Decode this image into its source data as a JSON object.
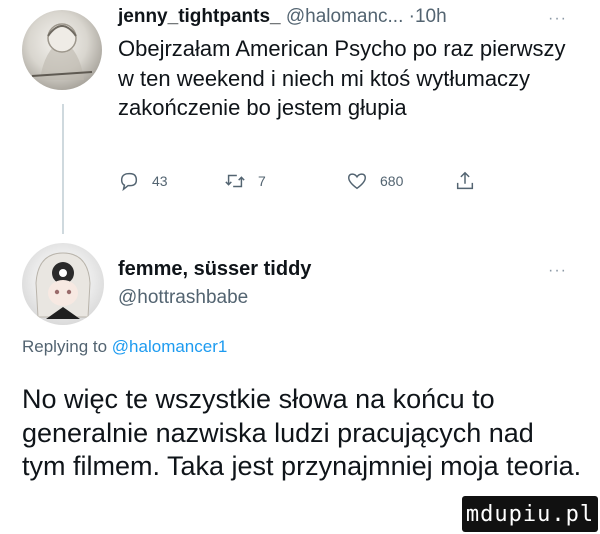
{
  "tweet1": {
    "author_name": "jenny_tightpants_",
    "handle": "@halomanc...",
    "separator": "·",
    "time": "10h",
    "more": "···",
    "text": "Obejrzałam American Psycho po raz pierwszy w ten weekend i niech mi ktoś wytłumaczy zakończenie bo jestem głupia",
    "actions": {
      "reply_icon": "speech-bubble-icon",
      "reply_count": "43",
      "retweet_icon": "retweet-icon",
      "retweet_count": "7",
      "like_icon": "heart-icon",
      "like_count": "680",
      "share_icon": "share-icon"
    }
  },
  "tweet2": {
    "author_name": "femme, süsser tiddy",
    "handle": "@hottrashbabe",
    "more": "···",
    "replying_prefix": "Replying to",
    "replying_to": "@halomancer1",
    "text": "No więc te wszystkie słowa na końcu to generalnie nazwiska ludzi pracujących nad tym filmem. Taka jest przynajmniej moja teoria."
  },
  "watermark": {
    "text": "mdupiu.pl"
  },
  "colors": {
    "text": "#0f1419",
    "secondary": "#536471",
    "link": "#1d9bf0",
    "thread_line": "#cfd9de"
  }
}
